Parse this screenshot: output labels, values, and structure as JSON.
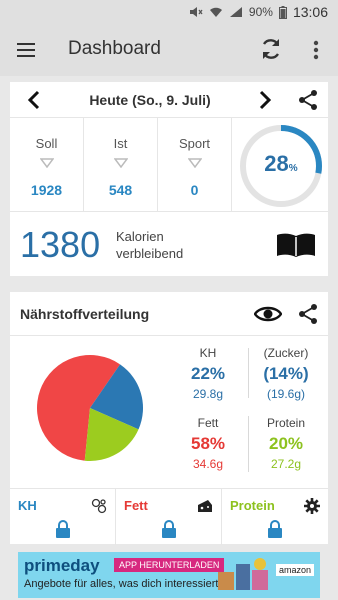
{
  "statusbar": {
    "battery": "90%",
    "time": "13:06"
  },
  "appbar": {
    "title": "Dashboard"
  },
  "date_nav": {
    "date_label": "Heute (So., 9. Juli)"
  },
  "stats": [
    {
      "label": "Soll",
      "value": "1928"
    },
    {
      "label": "Ist",
      "value": "548"
    },
    {
      "label": "Sport",
      "value": "0"
    }
  ],
  "progress": {
    "percent": "28",
    "unit": "%",
    "fraction": 0.28
  },
  "remaining": {
    "value": "1380",
    "line1": "Kalorien",
    "line2": "verbleibend"
  },
  "nutrients": {
    "title": "Nährstoffverteilung",
    "kh": {
      "label": "KH",
      "percent": "22%",
      "grams": "29.8g"
    },
    "zucker": {
      "label": "(Zucker)",
      "percent": "(14%)",
      "grams": "(19.6g)"
    },
    "fett": {
      "label": "Fett",
      "percent": "58%",
      "grams": "34.6g"
    },
    "protein": {
      "label": "Protein",
      "percent": "20%",
      "grams": "27.2g"
    }
  },
  "chart_data": {
    "type": "pie",
    "series": [
      {
        "name": "Fett",
        "value": 58,
        "color": "#f04646"
      },
      {
        "name": "KH",
        "value": 22,
        "color": "#2b78b3"
      },
      {
        "name": "Protein",
        "value": 20,
        "color": "#9ccc1f"
      }
    ]
  },
  "locks": [
    {
      "label": "KH",
      "color": "#2a87c2",
      "icon": "molecule-icon"
    },
    {
      "label": "Fett",
      "color": "#e53935",
      "icon": "cheese-icon"
    },
    {
      "label": "Protein",
      "color": "#8dc21f",
      "icon": "gear-icon"
    }
  ],
  "ad": {
    "brand": "primeday",
    "badge": "APP HERUNTERLADEN",
    "subline": "Angebote für alles, was dich interessiert",
    "logo": "amazon"
  },
  "colors": {
    "blue": "#2a87c2",
    "dark_blue": "#2a6fa6",
    "red": "#f04646",
    "green": "#9ccc1f"
  }
}
